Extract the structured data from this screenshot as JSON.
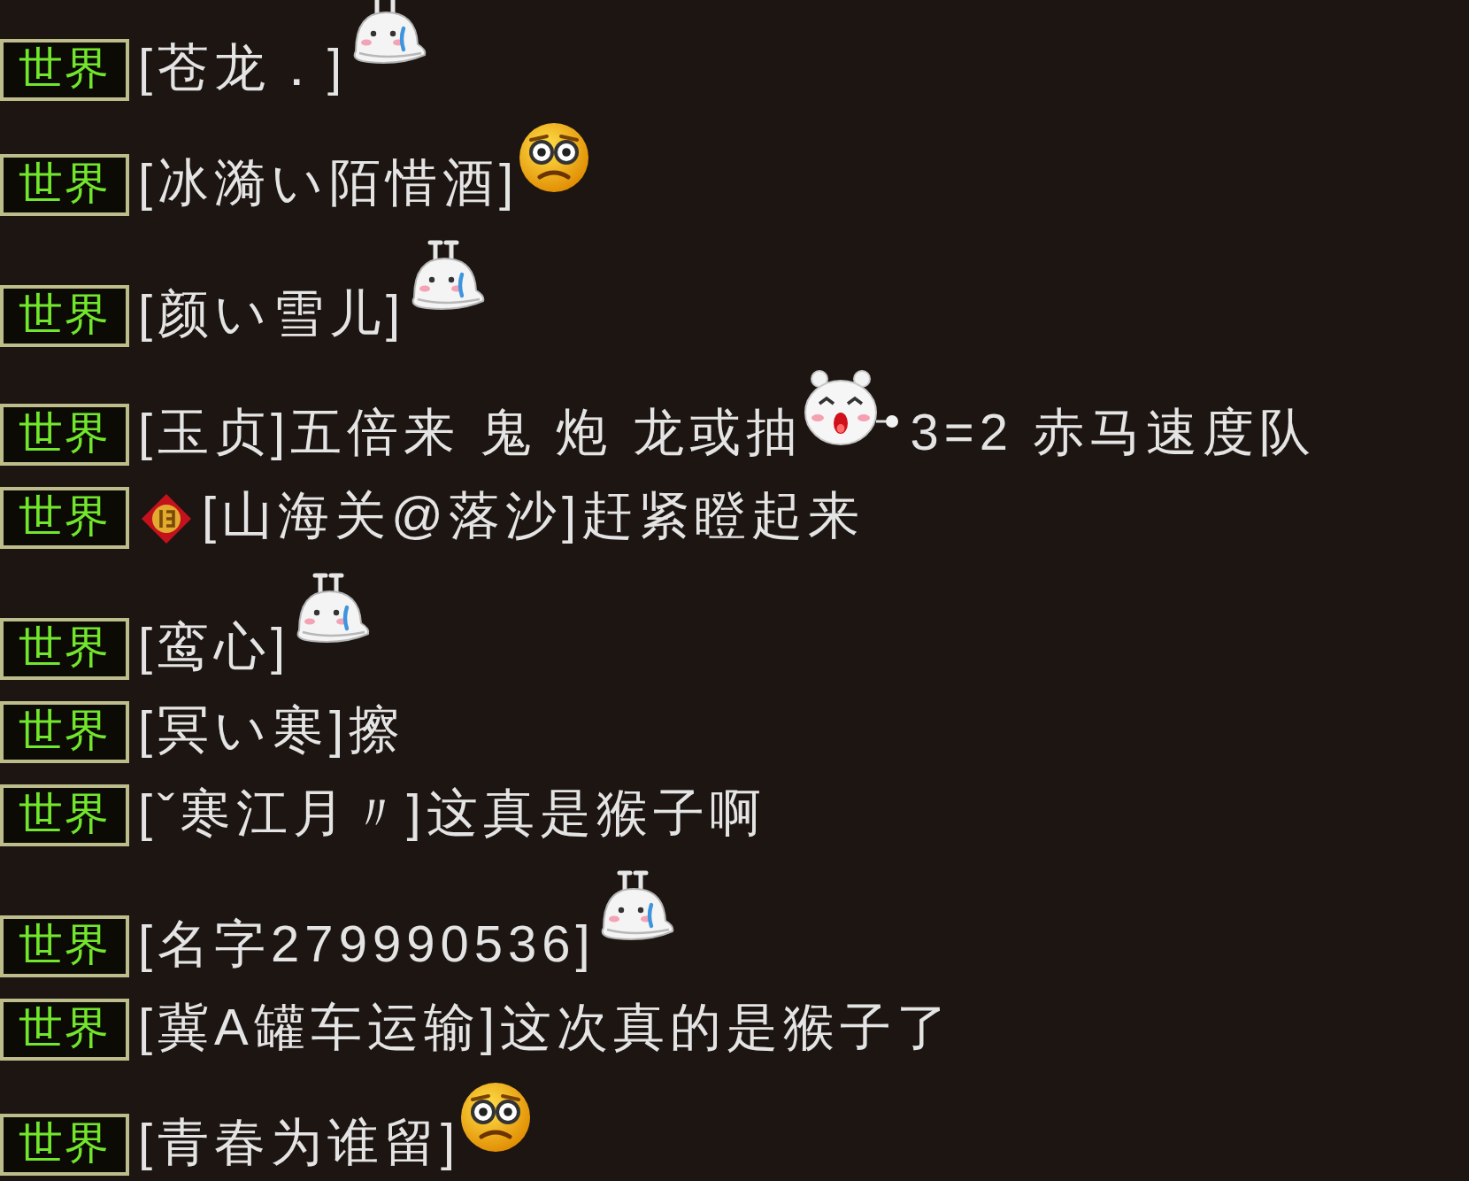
{
  "messages": [
    {
      "channel": "世界",
      "parts": [
        {
          "kind": "text",
          "text": "[苍龙．]"
        },
        {
          "kind": "blob"
        }
      ]
    },
    {
      "channel": "世界",
      "parts": [
        {
          "kind": "text",
          "text": "[冰漪い陌惜酒]"
        },
        {
          "kind": "face"
        }
      ]
    },
    {
      "channel": "世界",
      "parts": [
        {
          "kind": "text",
          "text": "[颜い雪儿]"
        },
        {
          "kind": "blob"
        }
      ]
    },
    {
      "channel": "世界",
      "parts": [
        {
          "kind": "text",
          "text": "[玉贞]五倍来 鬼 炮 龙或抽"
        },
        {
          "kind": "bear"
        },
        {
          "kind": "text",
          "text": "3=2 赤马速度队"
        }
      ]
    },
    {
      "channel": "世界",
      "parts": [
        {
          "kind": "emblem"
        },
        {
          "kind": "text",
          "text": "[山海关@落沙]赶紧瞪起来"
        }
      ]
    },
    {
      "channel": "世界",
      "parts": [
        {
          "kind": "text",
          "text": "[鸾心]"
        },
        {
          "kind": "blob"
        }
      ]
    },
    {
      "channel": "世界",
      "parts": [
        {
          "kind": "text",
          "text": "[冥い寒]擦"
        }
      ]
    },
    {
      "channel": "世界",
      "parts": [
        {
          "kind": "text",
          "text": "[ˇ寒江月〃]这真是猴子啊"
        }
      ]
    },
    {
      "channel": "世界",
      "parts": [
        {
          "kind": "text",
          "text": "[名字279990536]"
        },
        {
          "kind": "blob"
        }
      ]
    },
    {
      "channel": "世界",
      "parts": [
        {
          "kind": "text",
          "text": "[冀A罐车运输]这次真的是猴子了"
        }
      ]
    },
    {
      "channel": "世界",
      "parts": [
        {
          "kind": "text",
          "text": "[青春为谁留]"
        },
        {
          "kind": "face"
        }
      ]
    }
  ]
}
